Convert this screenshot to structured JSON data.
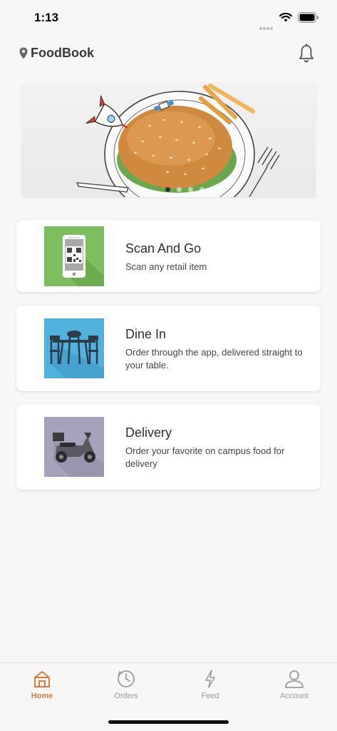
{
  "status_bar": {
    "time": "1:13"
  },
  "header": {
    "title": "FoodBook",
    "location_icon": "location-pin-icon",
    "notification_icon": "bell-icon"
  },
  "banner": {
    "image": "burger-on-plate-with-rocket-and-fries",
    "slide_count": 4,
    "active_slide": 1
  },
  "services": [
    {
      "title": "Scan And Go",
      "description": "Scan any retail item",
      "icon": "qr-phone-icon",
      "thumb_color": "#7dbf5e"
    },
    {
      "title": "Dine In",
      "description": "Order through the app, delivered straight to your table.",
      "icon": "dining-table-icon",
      "thumb_color": "#52b2de"
    },
    {
      "title": "Delivery",
      "description": "Order your favorite on campus food for delivery",
      "icon": "scooter-icon",
      "thumb_color": "#a5a2bb"
    }
  ],
  "tabs": [
    {
      "label": "Home",
      "icon": "home-icon",
      "active": true
    },
    {
      "label": "Orders",
      "icon": "clock-icon",
      "active": false
    },
    {
      "label": "Feed",
      "icon": "lightning-icon",
      "active": false
    },
    {
      "label": "Account",
      "icon": "user-icon",
      "active": false
    }
  ],
  "colors": {
    "accent": "#e07a3a",
    "inactive": "#9a9a9a",
    "background": "#f7f7f7"
  }
}
